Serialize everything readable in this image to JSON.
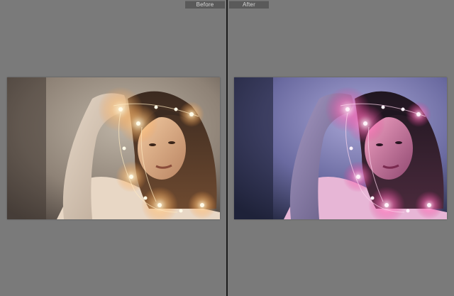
{
  "compare_view": {
    "before_label": "Before",
    "after_label": "After"
  },
  "photos": {
    "before": {
      "subject": "portrait-with-string-lights",
      "tone": "warm"
    },
    "after": {
      "subject": "portrait-with-string-lights",
      "tone": "cool-magenta"
    }
  },
  "colors": {
    "workspace_bg": "#7a7a7a",
    "divider": "#1c1c1c",
    "tab_bg": "#5a5a5a",
    "tab_text": "#d8d8d8"
  }
}
